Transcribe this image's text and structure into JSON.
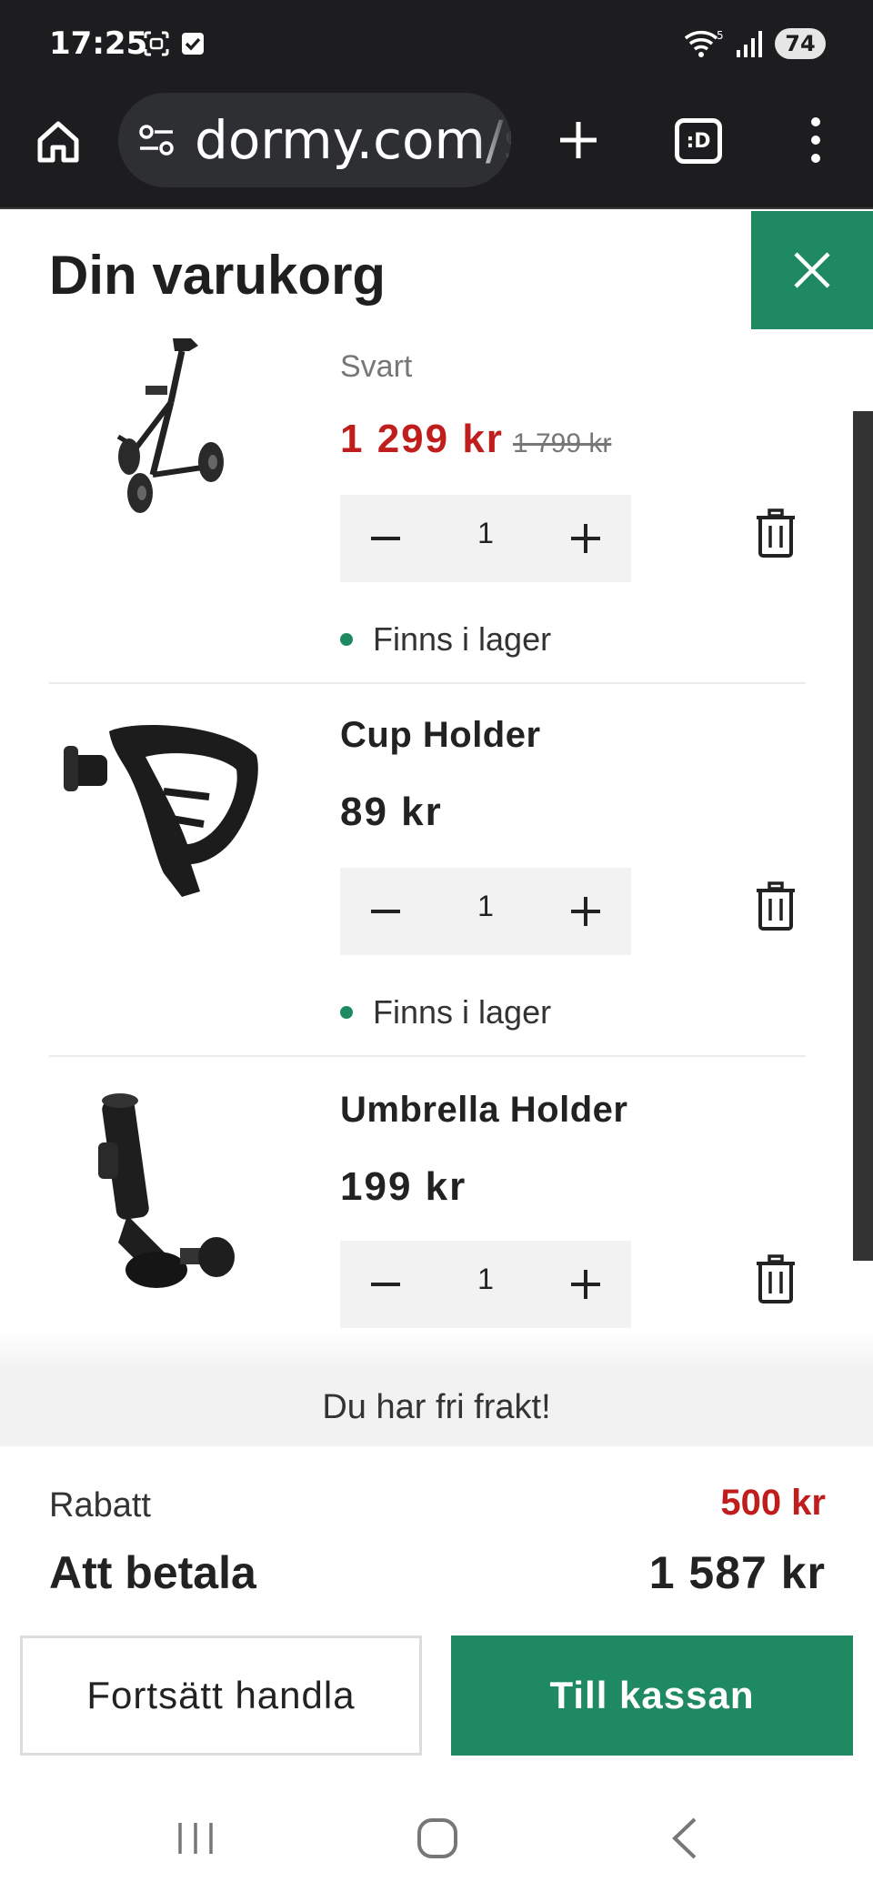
{
  "status_bar": {
    "time": "17:25",
    "network": "5",
    "battery": "74"
  },
  "browser": {
    "url": "dormy.com/s",
    "tabs_label": ":D"
  },
  "cart": {
    "title": "Din varukorg",
    "items": [
      {
        "name": "",
        "variant": "Svart",
        "price": "1 299 kr",
        "old_price": "1 799 kr",
        "quantity": "1",
        "stock": "Finns i lager",
        "image": "golf-trolley-image"
      },
      {
        "name": "Cup Holder",
        "price": "89 kr",
        "quantity": "1",
        "stock": "Finns i lager",
        "image": "cup-holder-image"
      },
      {
        "name": "Umbrella Holder",
        "price": "199 kr",
        "quantity": "1",
        "image": "umbrella-holder-image"
      }
    ],
    "free_shipping": "Du har fri frakt!",
    "discount_label": "Rabatt",
    "discount_value": "500 kr",
    "total_label": "Att betala",
    "total_value": "1 587 kr",
    "continue_label": "Fortsätt handla",
    "checkout_label": "Till kassan"
  },
  "colors": {
    "accent": "#1f8a62",
    "sale": "#c01d1d",
    "status_bar": "#1d1d1f"
  },
  "icons": [
    "home-icon",
    "site-settings-icon",
    "plus-icon",
    "tabs-icon",
    "more-icon",
    "close-icon",
    "minus-icon",
    "plus-icon",
    "trash-icon",
    "stock-dot-icon",
    "recent-apps-icon",
    "home-nav-icon",
    "back-icon"
  ]
}
